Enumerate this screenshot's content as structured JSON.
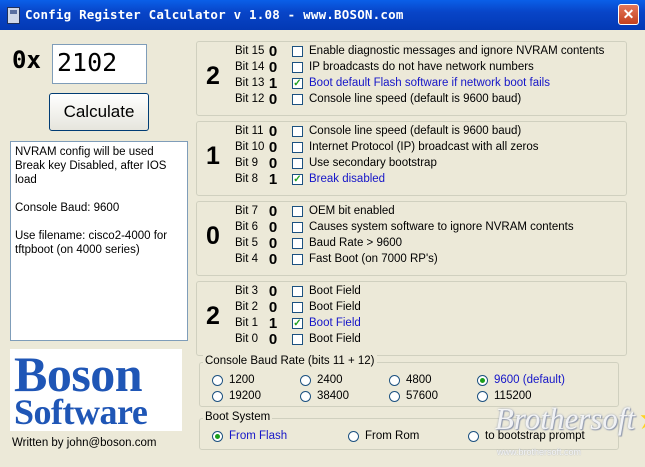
{
  "window": {
    "title": "Config Register Calculator v 1.08 - www.BOSON.com",
    "close_label": "✕"
  },
  "input": {
    "prefix": "0x",
    "value": "2102"
  },
  "calculate_label": "Calculate",
  "output_text": "NVRAM config will be used\nBreak key Disabled, after IOS load\n\nConsole Baud: 9600\n\nUse filename: cisco2-4000 for\ntftpboot (on 4000 series)",
  "nibbles": [
    {
      "digit": "2",
      "bits": [
        {
          "label": "Bit 15",
          "value": "0",
          "checked": false,
          "desc": "Enable diagnostic messages and ignore NVRAM contents"
        },
        {
          "label": "Bit 14",
          "value": "0",
          "checked": false,
          "desc": "IP broadcasts do not have network numbers"
        },
        {
          "label": "Bit 13",
          "value": "1",
          "checked": true,
          "desc": "Boot default Flash software if network boot fails"
        },
        {
          "label": "Bit 12",
          "value": "0",
          "checked": false,
          "desc": "Console line speed (default is 9600 baud)"
        }
      ]
    },
    {
      "digit": "1",
      "bits": [
        {
          "label": "Bit 11",
          "value": "0",
          "checked": false,
          "desc": "Console line speed (default is 9600 baud)"
        },
        {
          "label": "Bit 10",
          "value": "0",
          "checked": false,
          "desc": "Internet Protocol (IP) broadcast with all zeros"
        },
        {
          "label": "Bit 9",
          "value": "0",
          "checked": false,
          "desc": "Use secondary bootstrap"
        },
        {
          "label": "Bit 8",
          "value": "1",
          "checked": true,
          "desc": "Break disabled"
        }
      ]
    },
    {
      "digit": "0",
      "bits": [
        {
          "label": "Bit 7",
          "value": "0",
          "checked": false,
          "desc": "OEM bit enabled"
        },
        {
          "label": "Bit 6",
          "value": "0",
          "checked": false,
          "desc": "Causes system software to ignore NVRAM contents"
        },
        {
          "label": "Bit 5",
          "value": "0",
          "checked": false,
          "desc": "Baud Rate > 9600"
        },
        {
          "label": "Bit 4",
          "value": "0",
          "checked": false,
          "desc": "Fast Boot  (on 7000 RP's)"
        }
      ]
    },
    {
      "digit": "2",
      "bits": [
        {
          "label": "Bit 3",
          "value": "0",
          "checked": false,
          "desc": "Boot Field"
        },
        {
          "label": "Bit 2",
          "value": "0",
          "checked": false,
          "desc": "Boot Field"
        },
        {
          "label": "Bit 1",
          "value": "1",
          "checked": true,
          "desc": "Boot Field"
        },
        {
          "label": "Bit 0",
          "value": "0",
          "checked": false,
          "desc": "Boot Field"
        }
      ]
    }
  ],
  "baud": {
    "title": "Console Baud Rate (bits 11 + 12)",
    "options": [
      "1200",
      "2400",
      "4800",
      "9600 (default)",
      "19200",
      "38400",
      "57600",
      "115200"
    ],
    "selected": "9600 (default)"
  },
  "boot": {
    "title": "Boot System",
    "options": [
      "From Flash",
      "From Rom",
      "to bootstrap prompt"
    ],
    "selected": "From Flash"
  },
  "logo": {
    "line1": "Boson",
    "line2": "Software"
  },
  "written_by": "Written by john@boson.com",
  "watermark": {
    "text_a": "Brothersoft",
    "text_b": "www.brothersoft.com"
  },
  "colors": {
    "title_bar": "#0845c8",
    "checked_text": "#1515c8",
    "logo": "#1f56b6",
    "check_mark": "#21a121"
  }
}
